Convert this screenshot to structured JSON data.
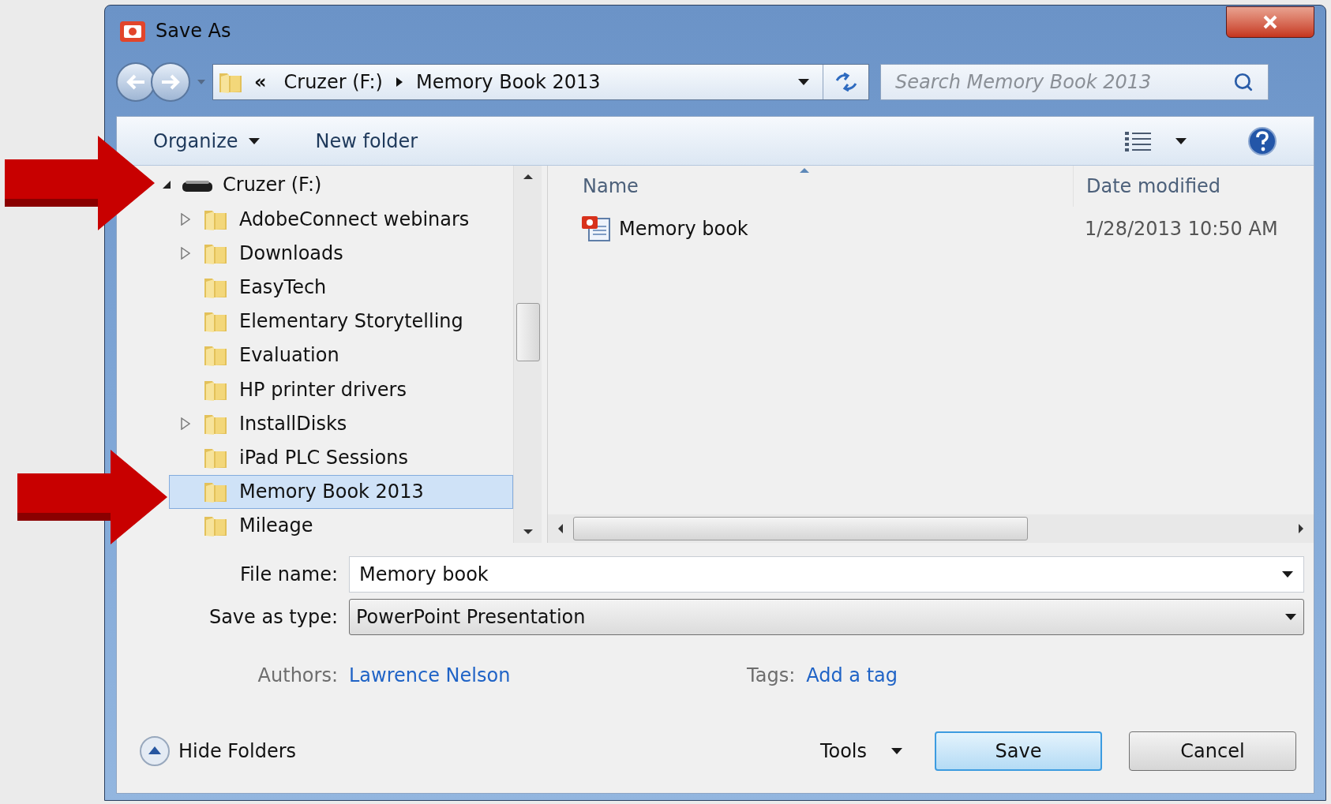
{
  "window": {
    "title": "Save As"
  },
  "address_bar": {
    "overflow": "«",
    "crumbs": [
      "Cruzer (F:)",
      "Memory Book 2013"
    ]
  },
  "search": {
    "placeholder": "Search Memory Book 2013"
  },
  "toolbar": {
    "organize": "Organize",
    "new_folder": "New folder"
  },
  "tree": {
    "label": "Cruzer (F:)",
    "expanded": true,
    "children": [
      {
        "label": "AdobeConnect webinars",
        "expandable": true,
        "selected": false
      },
      {
        "label": "Downloads",
        "expandable": true,
        "selected": false
      },
      {
        "label": "EasyTech",
        "expandable": false,
        "selected": false
      },
      {
        "label": "Elementary Storytelling",
        "expandable": false,
        "selected": false
      },
      {
        "label": "Evaluation",
        "expandable": false,
        "selected": false
      },
      {
        "label": "HP printer drivers",
        "expandable": false,
        "selected": false
      },
      {
        "label": "InstallDisks",
        "expandable": true,
        "selected": false
      },
      {
        "label": "iPad PLC Sessions",
        "expandable": false,
        "selected": false
      },
      {
        "label": "Memory Book 2013",
        "expandable": false,
        "selected": true
      },
      {
        "label": "Mileage",
        "expandable": false,
        "selected": false
      }
    ]
  },
  "files": {
    "columns": [
      "Name",
      "Date modified"
    ],
    "rows": [
      {
        "name": "Memory book",
        "date": "1/28/2013 10:50 AM"
      }
    ]
  },
  "form": {
    "file_name": {
      "label": "File name:",
      "value": "Memory book"
    },
    "save_type": {
      "label": "Save as type:",
      "value": "PowerPoint Presentation"
    },
    "authors": {
      "label": "Authors:",
      "value": "Lawrence Nelson"
    },
    "tags": {
      "label": "Tags:",
      "value": "Add a tag"
    }
  },
  "footer": {
    "hide_folders": "Hide Folders",
    "tools": "Tools",
    "save": "Save",
    "cancel": "Cancel"
  }
}
